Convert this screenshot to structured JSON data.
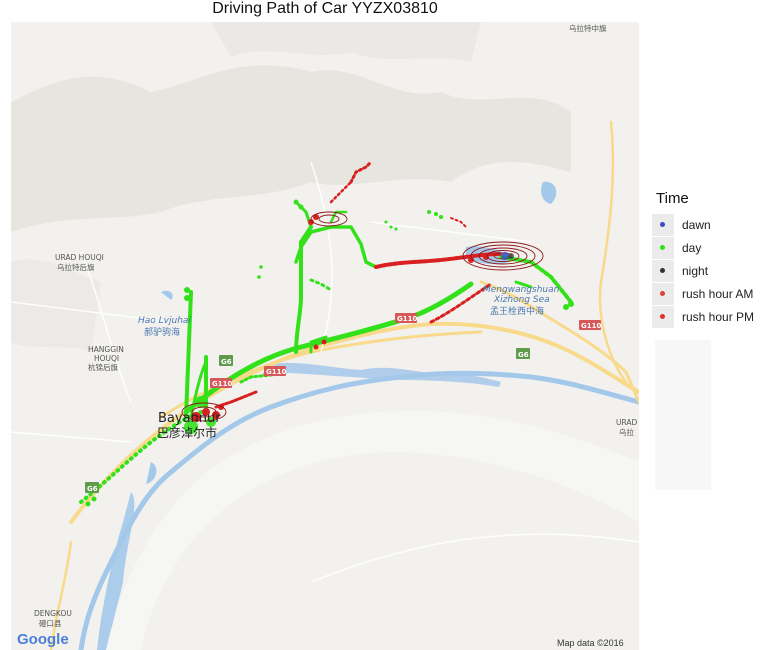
{
  "title": "Driving Path of Car YYZX03810",
  "legend": {
    "title": "Time",
    "items": [
      {
        "label": "dawn",
        "color": "#3b4cc0"
      },
      {
        "label": "day",
        "color": "#33e11a"
      },
      {
        "label": "night",
        "color": "#333333"
      },
      {
        "label": "rush hour AM",
        "color": "#e04040"
      },
      {
        "label": "rush hour PM",
        "color": "#e23030"
      }
    ]
  },
  "map_labels": {
    "urad_houqi_en": "URAD HOUQI",
    "urad_houqi_cn": "乌拉特后旗",
    "hao_lv_en": "Hao Lvjuhai",
    "hao_lv_cn": "郝驴驹海",
    "hanggin_1": "HANGGIN",
    "hanggin_2": "HOUQI",
    "hanggin_cn": "杭锦后旗",
    "bayannur_en": "Bayannur",
    "bayannur_cn": "巴彦淖尔市",
    "mengwang_1": "Mengwangshuan",
    "mengwang_2": "Xizhong Sea",
    "mengwang_cn": "孟王栓西中海",
    "urad_middle_cn": "乌拉特中旗",
    "urad_right_1": "URAD",
    "urad_right_2": "乌拉",
    "dengkou_en": "DENGKOU",
    "dengkou_cn": "磴口县",
    "g6_a": "G6",
    "g6_b": "G6",
    "g6_c": "G6",
    "g110_a": "G110",
    "g110_b": "G110",
    "g110_c": "G110",
    "g110_d": "G110"
  },
  "attribution": {
    "google": "Google",
    "mapdata": "Map data ©2016"
  },
  "colors": {
    "land": "#f2f1ee",
    "terrain": "#e6e4de",
    "water": "#a4c8ea",
    "road_major": "#f9d98a",
    "road_minor": "#ffffff",
    "route_day": "#33e11a",
    "route_rush": "#d92020",
    "density": "#8b1a1a"
  }
}
